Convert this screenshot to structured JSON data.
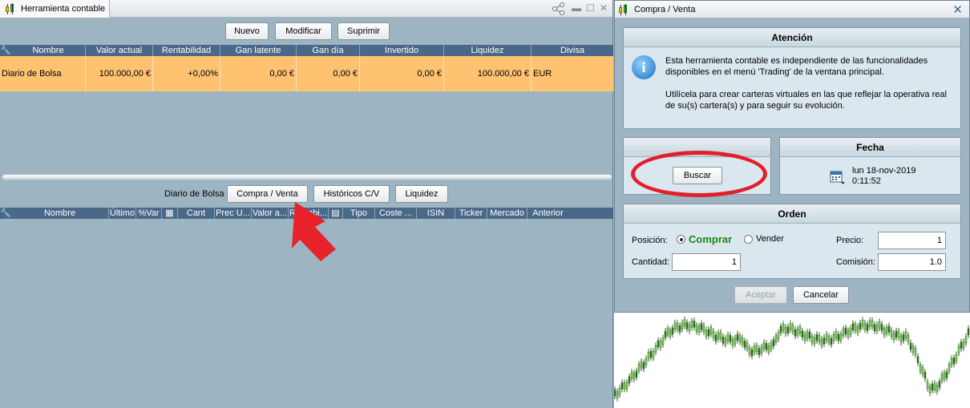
{
  "left_window": {
    "title": "Herramienta contable",
    "toolbar": {
      "nuevo": "Nuevo",
      "modificar": "Modificar",
      "suprimir": "Suprimir"
    },
    "portfolio_table": {
      "columns": [
        "Nombre",
        "Valor actual",
        "Rentabilidad",
        "Gan latente",
        "Gan día",
        "Invertido",
        "Liquidez",
        "Divisa"
      ],
      "rows": [
        {
          "nombre": "Diario de Bolsa",
          "valor_actual": "100.000,00 €",
          "rentabilidad": "+0,00%",
          "gan_latente": "0,00 €",
          "gan_dia": "0,00 €",
          "invertido": "0,00 €",
          "liquidez": "100.000,00 €",
          "divisa": "EUR"
        }
      ]
    },
    "section_label": "Diario de Bolsa",
    "section_buttons": {
      "compra_venta": "Compra / Venta",
      "historicos": "Históricos C/V",
      "liquidez": "Liquidez"
    },
    "positions_columns": [
      "Nombre",
      "Último",
      "%Var",
      "Cant",
      "Prec U...",
      "Valor a...",
      "Rentabi...",
      "Tipo",
      "Coste ...",
      "ISIN",
      "Ticker",
      "Mercado",
      "Anterior"
    ]
  },
  "dialog": {
    "title": "Compra / Venta",
    "atencion": {
      "header": "Atención",
      "paragraph1_line1": "Esta herramienta contable es independiente de las funcionalidades",
      "paragraph1_line2": "disponibles en el menú 'Trading' de la ventana principal.",
      "paragraph2_line1": "Utilícela para crear carteras virtuales en las que reflejar la operativa real",
      "paragraph2_line2": "de su(s) cartera(s) y para seguir su evolución."
    },
    "buscar_label": "Buscar",
    "fecha": {
      "header": "Fecha",
      "date": "lun 18-nov-2019",
      "time": "0:11:52"
    },
    "orden": {
      "header": "Orden",
      "posicion_label": "Posición:",
      "comprar": "Comprar",
      "vender": "Vender",
      "selected": "Comprar",
      "precio_label": "Precio:",
      "precio_value": "1",
      "cantidad_label": "Cantidad:",
      "cantidad_value": "1",
      "comision_label": "Comisión:",
      "comision_value": "1.0"
    },
    "aceptar": "Aceptar",
    "cancelar": "Cancelar"
  },
  "colors": {
    "highlight_row": "#fec271",
    "header_blue": "#4a6887",
    "annotation_red": "#e0202a",
    "comprar_green": "#1a8a1a"
  }
}
